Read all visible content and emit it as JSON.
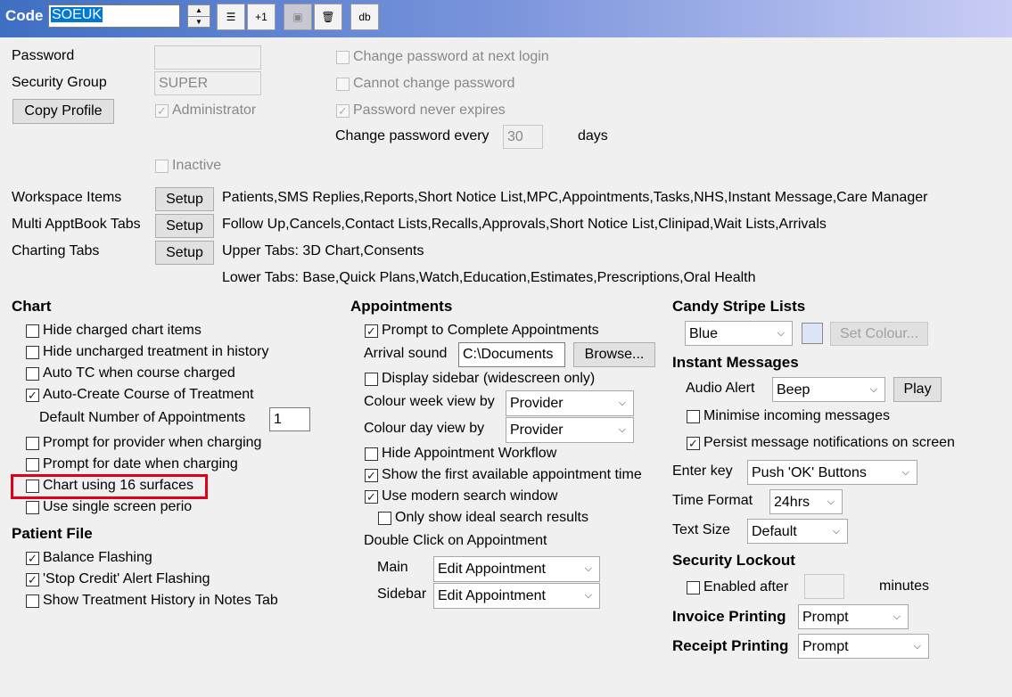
{
  "header": {
    "code_label": "Code",
    "code_value": "SOEUK",
    "align_icon": "text-align-left-icon",
    "plus_one_label": "+1",
    "save_icon": "save-icon",
    "delete_icon": "trash-icon",
    "db_label": "db"
  },
  "account": {
    "password_label": "Password",
    "password_value": "",
    "security_group_label": "Security Group",
    "security_group_value": "SUPER",
    "copy_profile_label": "Copy Profile",
    "administrator_label": "Administrator",
    "inactive_label": "Inactive",
    "change_at_next_login_label": "Change password at next login",
    "cannot_change_label": "Cannot change password",
    "never_expires_label": "Password never expires",
    "change_every_label": "Change password every",
    "change_every_value": "30",
    "days_label": "days"
  },
  "tabs": {
    "workspace_label": "Workspace Items",
    "workspace_value": "Patients,SMS Replies,Reports,Short Notice List,MPC,Appointments,Tasks,NHS,Instant Message,Care Manager",
    "multi_label": "Multi ApptBook Tabs",
    "multi_value": "Follow Up,Cancels,Contact Lists,Recalls,Approvals,Short Notice List,Clinipad,Wait Lists,Arrivals",
    "charting_label": "Charting Tabs",
    "charting_upper": "Upper Tabs: 3D Chart,Consents",
    "charting_lower": "Lower Tabs: Base,Quick Plans,Watch,Education,Estimates,Prescriptions,Oral Health",
    "setup_label": "Setup"
  },
  "chart": {
    "title": "Chart",
    "hide_charted": "Hide charged chart items",
    "hide_uncharged": "Hide uncharged treatment in history",
    "auto_tc": "Auto TC when course charged",
    "auto_create": "Auto-Create Course of Treatment",
    "default_num_label": "Default Number of Appointments",
    "default_num_value": "1",
    "prompt_provider": "Prompt for provider when charging",
    "prompt_date": "Prompt for date when charging",
    "surfaces16": "Chart using 16 surfaces",
    "single_perio": "Use single screen perio"
  },
  "patient_file": {
    "title": "Patient File",
    "balance_flashing": "Balance Flashing",
    "stop_credit": "'Stop Credit' Alert Flashing",
    "show_history": "Show Treatment History in Notes Tab"
  },
  "appointments": {
    "title": "Appointments",
    "prompt_complete": "Prompt to Complete Appointments",
    "arrival_sound_label": "Arrival sound",
    "arrival_sound_value": "C:\\Documents",
    "browse_label": "Browse...",
    "display_sidebar": "Display sidebar (widescreen only)",
    "colour_week_label": "Colour week view by",
    "colour_week_value": "Provider",
    "colour_day_label": "Colour day view by",
    "colour_day_value": "Provider",
    "hide_workflow": "Hide Appointment Workflow",
    "show_first": "Show the first available appointment time",
    "modern_search": "Use modern search window",
    "ideal_only": "Only show ideal search results",
    "double_click_label": "Double Click on Appointment",
    "main_label": "Main",
    "main_value": "Edit Appointment",
    "sidebar_label": "Sidebar",
    "sidebar_value": "Edit Appointment"
  },
  "right": {
    "candy_title": "Candy Stripe Lists",
    "candy_value": "Blue",
    "candy_swatch": "#dde6f8",
    "set_colour_label": "Set Colour...",
    "instant_title": "Instant Messages",
    "audio_label": "Audio Alert",
    "audio_value": "Beep",
    "play_label": "Play",
    "minimise": "Minimise incoming messages",
    "persist": "Persist message notifications on screen",
    "enter_key_label": "Enter key",
    "enter_key_value": "Push 'OK' Buttons",
    "time_format_label": "Time Format",
    "time_format_value": "24hrs",
    "text_size_label": "Text Size",
    "text_size_value": "Default",
    "security_title": "Security Lockout",
    "enabled_after": "Enabled after",
    "enabled_after_value": "",
    "minutes_label": "minutes",
    "invoice_label": "Invoice Printing",
    "invoice_value": "Prompt",
    "receipt_label": "Receipt Printing",
    "receipt_value": "Prompt"
  },
  "highlight_color": "#e1001a"
}
